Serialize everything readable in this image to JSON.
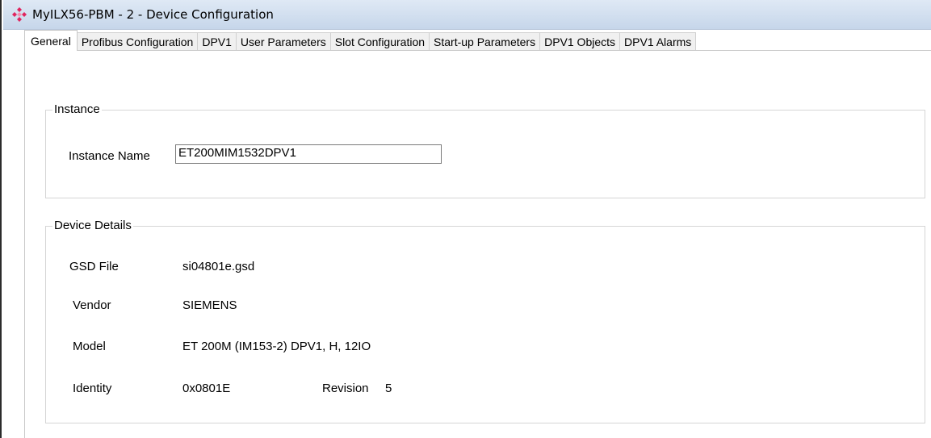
{
  "window": {
    "title": "MyILX56-PBM - 2 - Device Configuration",
    "icon": "network-diamond-icon"
  },
  "tabs": [
    {
      "label": "General",
      "active": true
    },
    {
      "label": "Profibus Configuration",
      "active": false
    },
    {
      "label": "DPV1",
      "active": false
    },
    {
      "label": "User Parameters",
      "active": false
    },
    {
      "label": "Slot Configuration",
      "active": false
    },
    {
      "label": "Start-up Parameters",
      "active": false
    },
    {
      "label": "DPV1 Objects",
      "active": false
    },
    {
      "label": "DPV1 Alarms",
      "active": false
    }
  ],
  "instance": {
    "legend": "Instance",
    "name_label": "Instance Name",
    "name_value": "ET200MIM1532DPV1"
  },
  "device_details": {
    "legend": "Device Details",
    "gsd_label": "GSD File",
    "gsd_value": "si04801e.gsd",
    "vendor_label": "Vendor",
    "vendor_value": "SIEMENS",
    "model_label": "Model",
    "model_value": "ET 200M (IM153-2) DPV1, H, 12IO",
    "identity_label": "Identity",
    "identity_value": "0x0801E",
    "revision_label": "Revision",
    "revision_value": "5"
  }
}
